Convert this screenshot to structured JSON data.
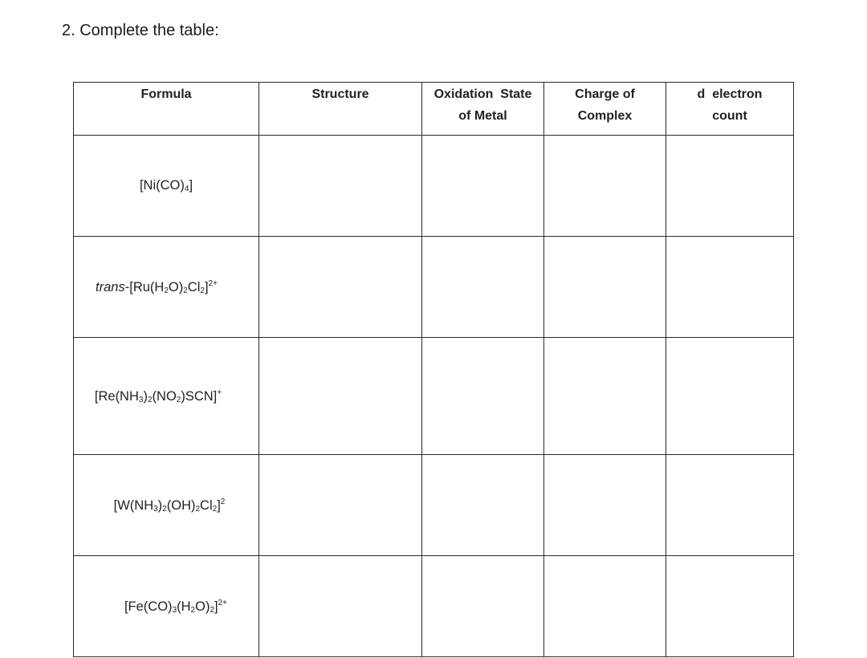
{
  "question": "2. Complete the table:",
  "table": {
    "headers": [
      {
        "line1": "Formula",
        "line2": ""
      },
      {
        "line1": "Structure",
        "line2": ""
      },
      {
        "line1": "Oxidation  State",
        "line2": "of Metal"
      },
      {
        "line1": "Charge of",
        "line2": "Complex"
      },
      {
        "line1": "d  electron",
        "line2": "count"
      }
    ],
    "rows": [
      {
        "formula_parts": [
          [
            "t",
            "[Ni(CO)"
          ],
          [
            "sub",
            "4"
          ],
          [
            "t",
            "]"
          ]
        ],
        "structure": "",
        "oxidation_state": "",
        "charge": "",
        "d_electron_count": ""
      },
      {
        "formula_parts": [
          [
            "i",
            "trans"
          ],
          [
            "t",
            "-[Ru(H"
          ],
          [
            "sub",
            "2"
          ],
          [
            "t",
            "O)"
          ],
          [
            "sub",
            "2"
          ],
          [
            "t",
            "Cl"
          ],
          [
            "sub",
            "2"
          ],
          [
            "t",
            "]"
          ],
          [
            "sup",
            "2+"
          ]
        ],
        "structure": "",
        "oxidation_state": "",
        "charge": "",
        "d_electron_count": ""
      },
      {
        "formula_parts": [
          [
            "t",
            "[Re(NH"
          ],
          [
            "sub",
            "3"
          ],
          [
            "t",
            ")"
          ],
          [
            "sub",
            "2"
          ],
          [
            "t",
            "(NO"
          ],
          [
            "sub",
            "2"
          ],
          [
            "t",
            ")SCN]"
          ],
          [
            "sup",
            "+"
          ]
        ],
        "structure": "",
        "oxidation_state": "",
        "charge": "",
        "d_electron_count": ""
      },
      {
        "formula_parts": [
          [
            "t",
            "[W(NH"
          ],
          [
            "sub",
            "3"
          ],
          [
            "t",
            ")"
          ],
          [
            "sub",
            "2"
          ],
          [
            "t",
            "(OH)"
          ],
          [
            "sub",
            "2"
          ],
          [
            "t",
            "Cl"
          ],
          [
            "sub",
            "2"
          ],
          [
            "t",
            "]"
          ],
          [
            "sup",
            "2"
          ]
        ],
        "structure": "",
        "oxidation_state": "",
        "charge": "",
        "d_electron_count": ""
      },
      {
        "formula_parts": [
          [
            "t",
            "[Fe(CO)"
          ],
          [
            "sub",
            "3"
          ],
          [
            "t",
            "(H"
          ],
          [
            "sub",
            "2"
          ],
          [
            "t",
            "O)"
          ],
          [
            "sub",
            "2"
          ],
          [
            "t",
            "]"
          ],
          [
            "sup",
            "2+"
          ]
        ],
        "structure": "",
        "oxidation_state": "",
        "charge": "",
        "d_electron_count": ""
      }
    ]
  }
}
